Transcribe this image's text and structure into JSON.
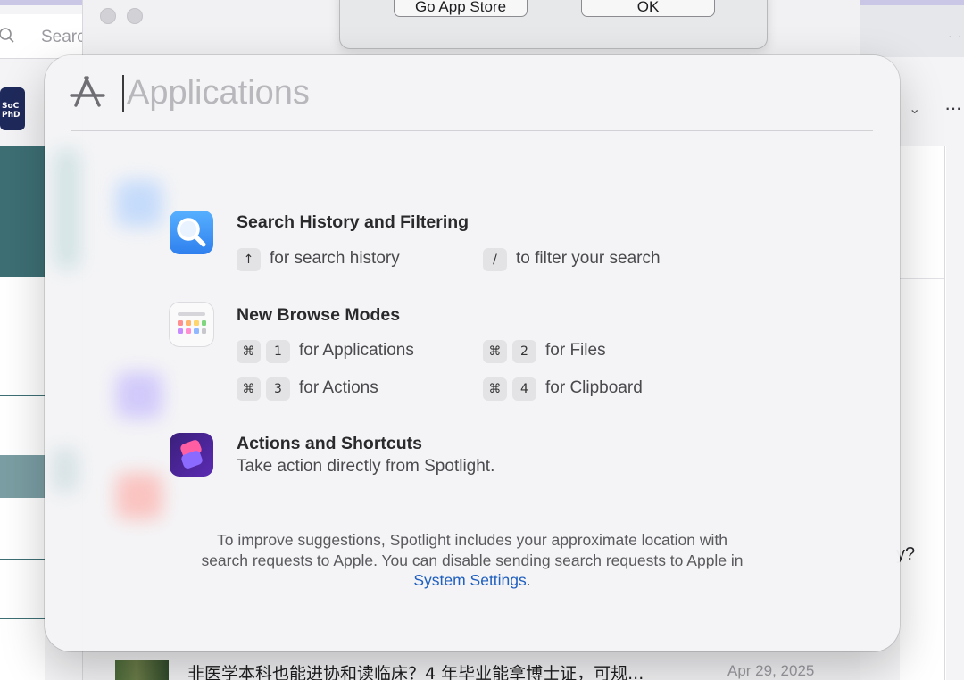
{
  "background": {
    "search_placeholder": "Search",
    "logo_text": [
      "SoC",
      "PhD"
    ],
    "article": {
      "title": "非医学本科也能进协和读临床？4 年毕业能拿博士证，可规...",
      "date": "Apr 29, 2025"
    },
    "right_edge_text": "y?"
  },
  "alert": {
    "buttons": [
      "Go App Store",
      "OK"
    ]
  },
  "spotlight": {
    "search_placeholder": "Applications",
    "sections": {
      "history": {
        "title": "Search History and Filtering",
        "hints": [
          {
            "keys": [
              "↑"
            ],
            "label": "for search history"
          },
          {
            "keys": [
              "/"
            ],
            "label": "to filter your search"
          }
        ]
      },
      "browse": {
        "title": "New Browse Modes",
        "hints": [
          {
            "keys": [
              "⌘",
              "1"
            ],
            "label": "for Applications"
          },
          {
            "keys": [
              "⌘",
              "2"
            ],
            "label": "for Files"
          },
          {
            "keys": [
              "⌘",
              "3"
            ],
            "label": "for Actions"
          },
          {
            "keys": [
              "⌘",
              "4"
            ],
            "label": "for Clipboard"
          }
        ]
      },
      "actions": {
        "title": "Actions and Shortcuts",
        "description": "Take action directly from Spotlight."
      }
    },
    "footer": {
      "line1": "To improve suggestions, Spotlight includes your approximate location with",
      "line2": "search requests to Apple. You can disable sending search requests to Apple in",
      "link": "System Settings",
      "period": "."
    }
  },
  "icons": {
    "mode": "app-store-icon",
    "history": "magnifier-icon",
    "browse": "launchpad-grid-icon",
    "actions": "shortcuts-icon"
  },
  "colors": {
    "accent_link": "#1f5fbf",
    "history_icon": "#2f8ef5",
    "shortcuts_icon": "#5b2bb3"
  }
}
